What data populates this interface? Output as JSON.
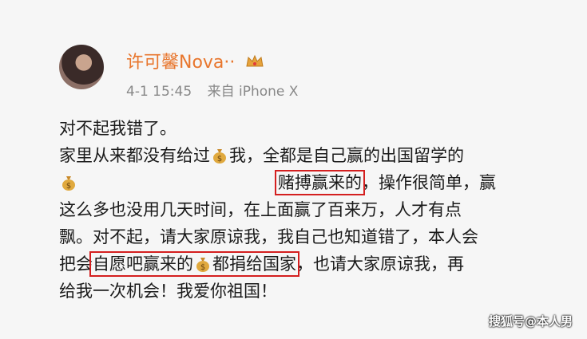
{
  "user": {
    "name": "许可馨Nova··",
    "badge_icon": "crown-icon"
  },
  "post_meta": {
    "date": "4-1 15:45",
    "source": "来自 iPhone X"
  },
  "content": {
    "line1": "对不起我错了。",
    "line2a": "家里从来都没有给过",
    "line2b": "我，全都是自己赢的出国留学的",
    "line3_highlight": "赌搏赢来的",
    "line3b": "，操作很简单，赢",
    "line4": "这么多也没用几天时间，在上面赢了百来万，人才有点",
    "line5": "飘。对不起，请大家原谅我，我自己也知道错了，本人会",
    "line6a": "把会",
    "line6_highlight_a": "自愿吧赢来的",
    "line6_highlight_b": "都捐给国家",
    "line6b": "，也请大家原谅我，再",
    "line7": "给我一次机会！我爱你祖国！"
  },
  "watermark": "搜狐号@本人男",
  "colors": {
    "username": "#e8762d",
    "highlight_box": "#d41f1f",
    "text": "#1a1a1a",
    "meta": "#888888"
  }
}
